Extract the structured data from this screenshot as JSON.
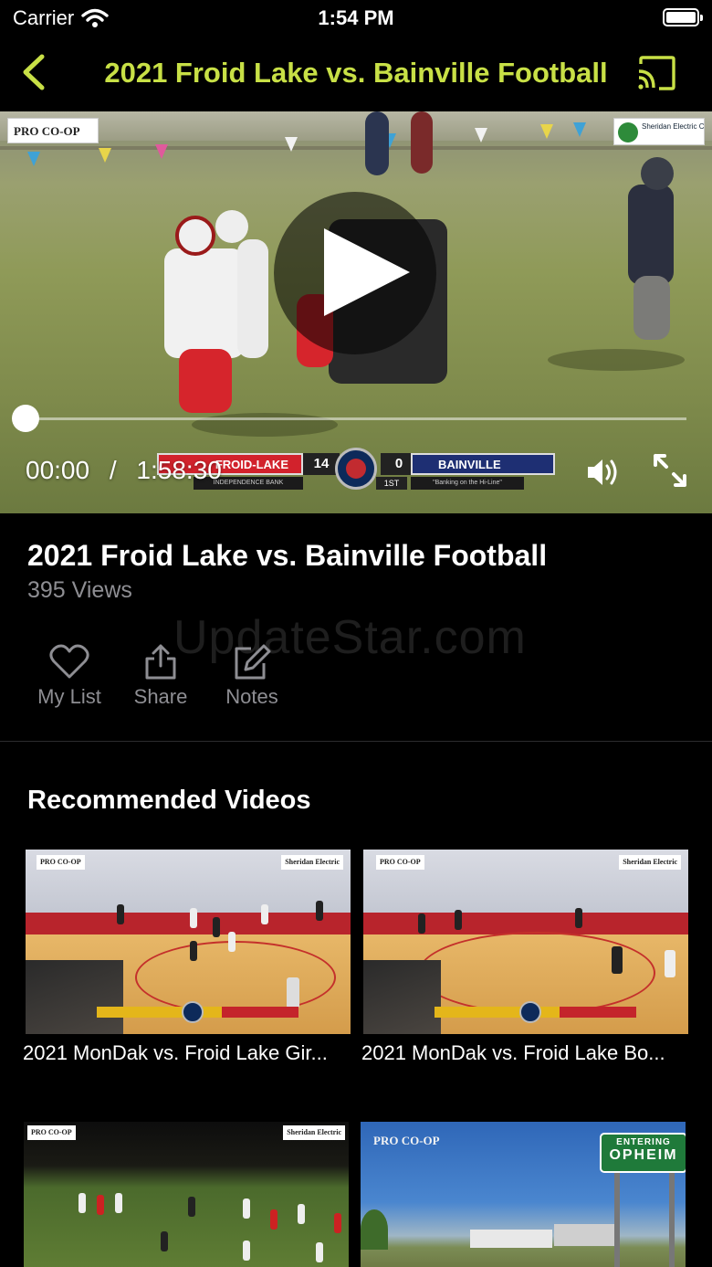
{
  "status_bar": {
    "carrier": "Carrier",
    "time": "1:54 PM"
  },
  "nav": {
    "title": "2021 Froid Lake vs. Bainville Football"
  },
  "player": {
    "logo_left": "PRO CO-OP",
    "logo_right": "Sheridan Electric Cooperative, Inc.",
    "current_time": "00:00",
    "separator": "/",
    "duration": "1:58:30",
    "progress": 0,
    "scorebug": {
      "home_team": "FROID-LAKE",
      "home_score": "14",
      "away_team": "BAINVILLE",
      "away_score": "0",
      "period": "1ST",
      "home_sponsor": "INDEPENDENCE BANK",
      "away_sponsor": "\"Banking on the Hi-Line\""
    }
  },
  "video": {
    "title": "2021 Froid Lake vs. Bainville Football",
    "views": "395 Views",
    "watermark": "UpdateStar.com"
  },
  "actions": [
    {
      "label": "My List",
      "icon": "heart-icon"
    },
    {
      "label": "Share",
      "icon": "share-icon"
    },
    {
      "label": "Notes",
      "icon": "edit-icon"
    }
  ],
  "recommended": {
    "title": "Recommended Videos",
    "items": [
      {
        "caption": "2021 MonDak vs. Froid Lake Gir..."
      },
      {
        "caption": "2021 MonDak vs. Froid Lake Bo..."
      },
      {
        "caption": ""
      },
      {
        "caption": "",
        "sign_line1": "ENTERING",
        "sign_line2": "OPHEIM"
      }
    ]
  },
  "colors": {
    "accent": "#c8e046",
    "background": "#000000",
    "secondary_text": "#8e8e93"
  }
}
